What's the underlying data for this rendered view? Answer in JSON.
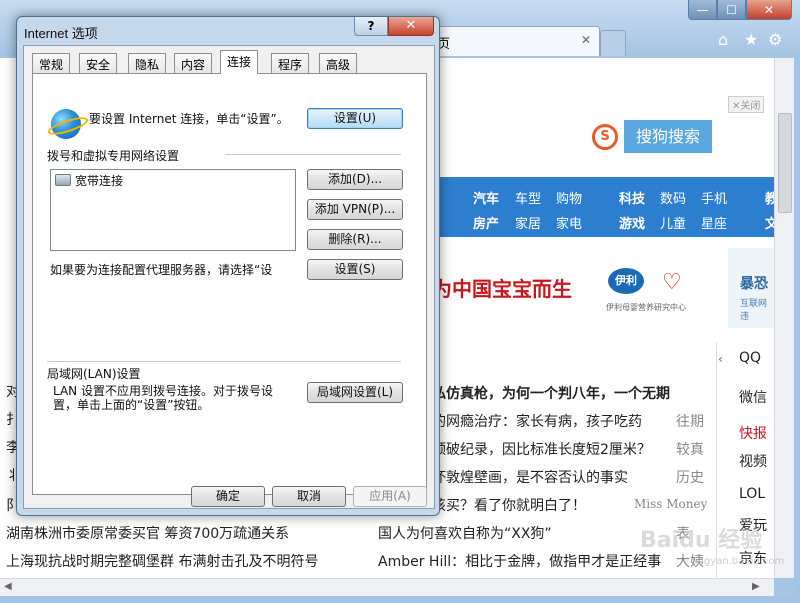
{
  "dialog": {
    "title": "Internet 选项",
    "help_label": "?",
    "close_label": "✕",
    "tabs": [
      "常规",
      "安全",
      "隐私",
      "内容",
      "连接",
      "程序",
      "高级"
    ],
    "active_tab": "连接",
    "setup_text": "要设置 Internet 连接，单击“设置”。",
    "setup_button": "设置(U)",
    "dialup_heading": "拨号和虚拟专用网络设置",
    "connections": [
      "宽带连接"
    ],
    "add_button": "添加(D)...",
    "add_vpn_button": "添加 VPN(P)...",
    "remove_button": "删除(R)...",
    "proxy_text": "如果要为连接配置代理服务器，请选择“设",
    "settings_button": "设置(S)",
    "lan_heading": "局域网(LAN)设置",
    "lan_text": "LAN 设置不应用到拨号连接。对于拨号设置，单击上面的“设置”按钮。",
    "lan_button": "局域网设置(L)",
    "ok_button": "确定",
    "cancel_button": "取消",
    "apply_button": "应用(A)"
  },
  "browser": {
    "tab_title": "讯首页",
    "tab_close": "✕",
    "window_buttons": {
      "min": "—",
      "max": "☐",
      "close": "✕"
    },
    "tools": {
      "home": "⌂",
      "favorites": "★",
      "settings": "⚙"
    },
    "ad_close_label": "✕关闭",
    "search_logo": "S",
    "search_button": "搜狗搜索",
    "nav_links": [
      [
        "汽车",
        "车型",
        "购物",
        "科技",
        "数码",
        "手机",
        "教"
      ],
      [
        "房产",
        "家居",
        "家电",
        "游戏",
        "儿童",
        "星座",
        "文"
      ]
    ],
    "banner_text": "为中国宝宝而生",
    "banner_logo": "伊利",
    "banner_heart": "♡",
    "banner_caption": "伊利母婴营养研究中心",
    "side_ad_title": "暴恐",
    "side_ad_sub": "互联网违",
    "side_arrow": "‹",
    "side_links": [
      "QQ",
      "微信",
      "快报",
      "视频",
      "LOL",
      "爱玩",
      "京东"
    ],
    "news": [
      {
        "text": "私仿真枪，为何一个判八年，一个无期",
        "tag": ""
      },
      {
        "text": "的网瘾治疗：家长有病，孩子吃药",
        "tag": "往期"
      },
      {
        "text": "颈破纪录，因比标准长度短2厘米？",
        "tag": "较真"
      },
      {
        "text": "坏敦煌壁画，是不容否认的事实",
        "tag": "历史"
      },
      {
        "text": "该买？看了你就明白了！",
        "tag": "Miss Money"
      },
      {
        "text": "国人为何喜欢自称为“XX狗”",
        "tag": "表"
      },
      {
        "text": "Amber Hill：相比于金牌，做指甲才是正经事",
        "tag": "大姨"
      }
    ],
    "left_news": [
      "湖南株洲市委原常委买官 筹资700万疏通关系",
      "上海现抗战时期完整碉堡群 布满射击孔及不明符号"
    ],
    "left_fragments": [
      "对",
      "扌",
      "李",
      "丬",
      "阝"
    ],
    "watermark": "Baidu 经验",
    "watermark_sub": "jingyan.baidu.com",
    "scroll_left": "◀",
    "scroll_right": "▶"
  }
}
